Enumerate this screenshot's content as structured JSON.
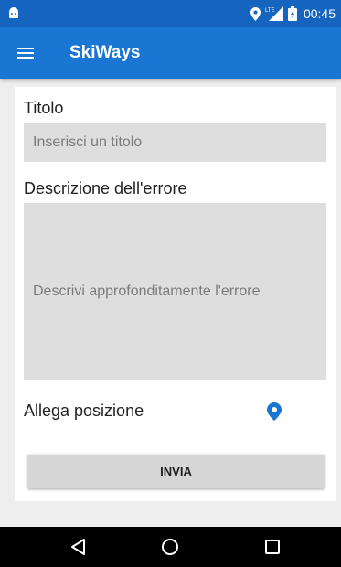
{
  "status_bar": {
    "time": "00:45",
    "icons": [
      "android-icon",
      "location-icon",
      "lte-signal-icon",
      "battery-icon"
    ]
  },
  "app_bar": {
    "title": "SkiWays",
    "menu_icon": "hamburger-menu-icon"
  },
  "form": {
    "title_label": "Titolo",
    "title_placeholder": "Inserisci un titolo",
    "description_label": "Descrizione dell'errore",
    "description_placeholder": "Descrivi approfonditamente l'errore",
    "attach_position_label": "Allega posizione",
    "attach_position_icon": "location-pin-icon",
    "submit_label": "INVIA"
  },
  "nav_bar": {
    "icons": [
      "back-icon",
      "home-icon",
      "recents-icon"
    ]
  },
  "colors": {
    "status_bar": "#1565c0",
    "app_bar": "#1976d2",
    "field_background": "#dedede",
    "pin": "#1976d2"
  }
}
